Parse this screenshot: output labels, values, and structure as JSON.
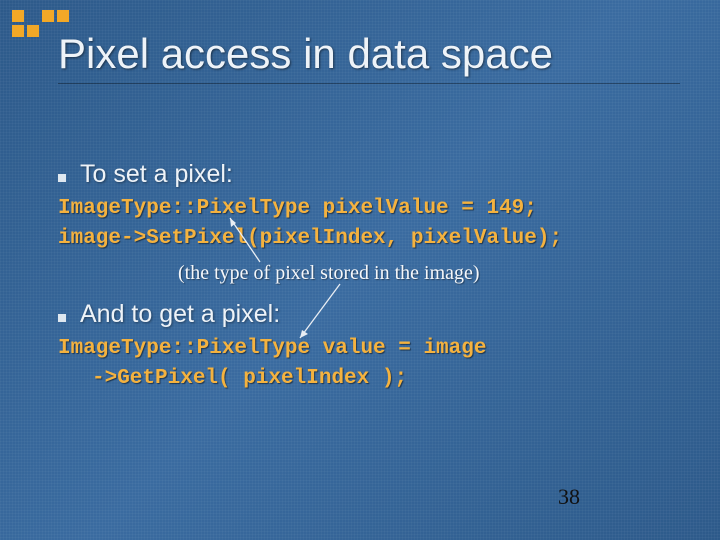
{
  "title": "Pixel access in data space",
  "bullets": {
    "set": "To set a pixel:",
    "get": "And to get a pixel:"
  },
  "code": {
    "set_line1": "ImageType::PixelType pixelValue = 149;",
    "set_line2": "image->SetPixel(pixelIndex, pixelValue);",
    "get_line1": "ImageType::PixelType value = image",
    "get_line2": "->GetPixel( pixelIndex );"
  },
  "annotation": "(the type of pixel stored in the image)",
  "page_number": "38"
}
